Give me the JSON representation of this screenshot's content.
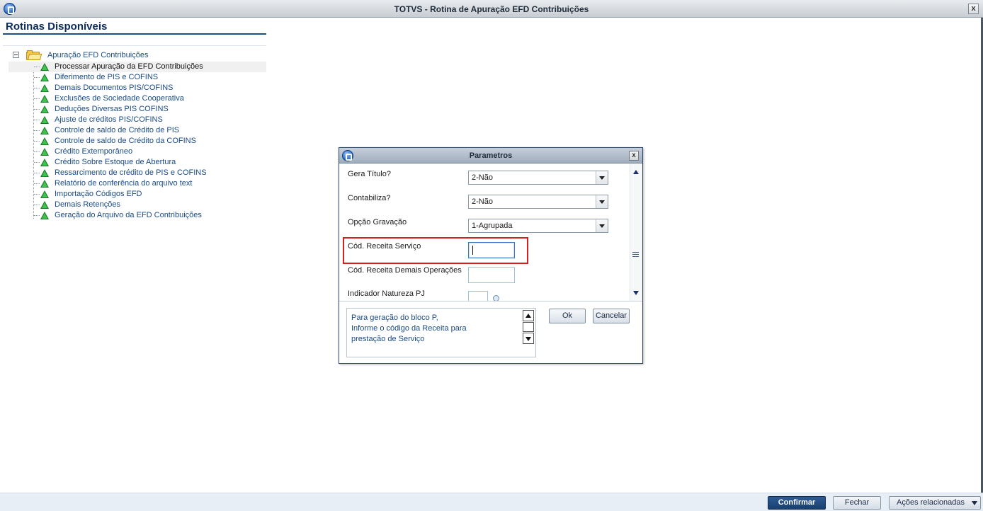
{
  "window": {
    "title": "TOTVS - Rotina de Apuração EFD Contribuições",
    "close_label": "x"
  },
  "left_panel": {
    "title": "Rotinas Disponíveis",
    "root_label": "Apuração EFD Contribuições",
    "items": [
      {
        "label": "Processar Apuração da EFD Contribuições",
        "selected": true
      },
      {
        "label": "Diferimento de PIS e COFINS"
      },
      {
        "label": "Demais Documentos PIS/COFINS"
      },
      {
        "label": "Exclusões de Sociedade Cooperativa"
      },
      {
        "label": "Deduções Diversas PIS COFINS"
      },
      {
        "label": "Ajuste de créditos PIS/COFINS"
      },
      {
        "label": "Controle de saldo de Crédito de PIS"
      },
      {
        "label": "Controle de saldo de Crédito da COFINS"
      },
      {
        "label": "Crédito Extemporâneo"
      },
      {
        "label": "Crédito Sobre Estoque de Abertura"
      },
      {
        "label": "Ressarcimento de crédito de PIS e COFINS"
      },
      {
        "label": "Relatório de conferência do arquivo text"
      },
      {
        "label": "Importação Códigos EFD"
      },
      {
        "label": "Demais Retenções"
      },
      {
        "label": "Geração do Arquivo da EFD Contribuições"
      }
    ]
  },
  "dialog": {
    "title": "Parametros",
    "close_label": "x",
    "fields": {
      "gera_titulo": {
        "label": "Gera Título?",
        "value": "2-Não"
      },
      "contabiliza": {
        "label": "Contabiliza?",
        "value": "2-Não"
      },
      "opcao_gravacao": {
        "label": "Opção Gravação",
        "value": "1-Agrupada"
      },
      "cod_receita_servico": {
        "label": "Cód. Receita Serviço",
        "value": ""
      },
      "cod_receita_demais": {
        "label": "Cód. Receita Demais Operações",
        "value": ""
      },
      "indicador_natureza": {
        "label": "Indicador Natureza PJ",
        "value": ""
      }
    },
    "help_lines": [
      "Para geração do bloco P,",
      "Informe o código da Receita para",
      "prestação de Serviço"
    ],
    "ok_label": "Ok",
    "cancel_label": "Cancelar"
  },
  "footer": {
    "confirm_label": "Confirmar",
    "close_label": "Fechar",
    "actions_label": "Ações relacionadas"
  },
  "colors": {
    "accent": "#18406f",
    "highlight": "#d52020",
    "tree_icon": "#3ec44d"
  },
  "icons": [
    "app-logo-icon",
    "close-icon",
    "folder-icon",
    "green-triangle-icon",
    "chevron-down-icon",
    "scroll-up-icon",
    "scroll-down-icon",
    "lookup-icon"
  ]
}
